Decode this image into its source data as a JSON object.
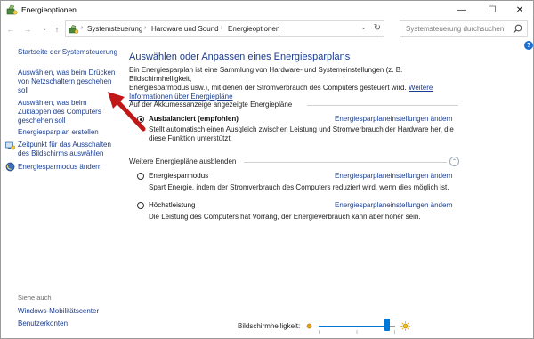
{
  "window": {
    "title": "Energieoptionen",
    "minimize_glyph": "—",
    "maximize_glyph": "☐",
    "close_glyph": "✕"
  },
  "navigation": {
    "back_glyph": "←",
    "forward_glyph": "→",
    "recent_glyph": "⌄",
    "up_glyph": "↑",
    "breadcrumbs": [
      "Systemsteuerung",
      "Hardware und Sound",
      "Energieoptionen"
    ],
    "separator": "›",
    "dropdown_glyph": "⌄",
    "refresh_glyph": "↻",
    "search_placeholder": "Systemsteuerung durchsuchen"
  },
  "sidebar": {
    "home_link": "Startseite der Systemsteuerung",
    "links": [
      {
        "lines": [
          "Auswählen, was beim Drücken",
          "von Netzschaltern geschehen",
          "soll"
        ]
      },
      {
        "lines": [
          "Auswählen, was beim",
          "Zuklappen des Computers",
          "geschehen soll"
        ]
      },
      {
        "lines": [
          "Energiesparplan erstellen"
        ]
      },
      {
        "lines": [
          "Zeitpunkt für das Ausschalten",
          "des Bildschirms auswählen"
        ],
        "icon": "monitor-shield-icon"
      },
      {
        "lines": [
          "Energiesparmodus ändern"
        ],
        "icon": "moon-globe-icon"
      }
    ],
    "see_also_label": "Siehe auch",
    "see_also_links": [
      "Windows-Mobilitätscenter",
      "Benutzerkonten"
    ]
  },
  "main": {
    "help_glyph": "?",
    "title": "Auswählen oder Anpassen eines Energiesparplans",
    "intro_line1": "Ein Energiesparplan ist eine Sammlung von Hardware- und Systemeinstellungen (z. B. Bildschirmhelligkeit,",
    "intro_line2_text": "Energiesparmodus usw.), mit denen der Stromverbrauch des Computers gesteuert wird.",
    "intro_link1": "Weitere",
    "intro_link2": "Informationen über Energiepläne",
    "battery_group_label": "Auf der Akkumessanzeige angezeigte Energiepläne",
    "hidden_group_label": "Weitere Energiepläne ausblenden",
    "collapse_glyph": "⌃",
    "plans": [
      {
        "name": "Ausbalanciert (empfohlen)",
        "selected": true,
        "desc_line1": "Stellt automatisch einen Ausgleich zwischen Leistung und Stromverbrauch der Hardware her, die",
        "desc_line2": "diese Funktion unterstützt.",
        "link": "Energiesparplaneinstellungen ändern"
      },
      {
        "name": "Energiesparmodus",
        "selected": false,
        "desc_line1": "Spart Energie, indem der Stromverbrauch des Computers reduziert wird, wenn dies möglich ist.",
        "desc_line2": "",
        "link": "Energiesparplaneinstellungen ändern"
      },
      {
        "name": "Höchstleistung",
        "selected": false,
        "desc_line1": "Die Leistung des Computers hat Vorrang, der Energieverbrauch kann aber höher sein.",
        "desc_line2": "",
        "link": "Energiesparplaneinstellungen ändern"
      }
    ]
  },
  "brightness": {
    "label": "Bildschirmhelligkeit:",
    "level_percent": 90
  },
  "colors": {
    "link": "#1a3d8f",
    "title": "#1b3c8c",
    "accent": "#0078d7",
    "annotation_arrow": "#c01818"
  }
}
